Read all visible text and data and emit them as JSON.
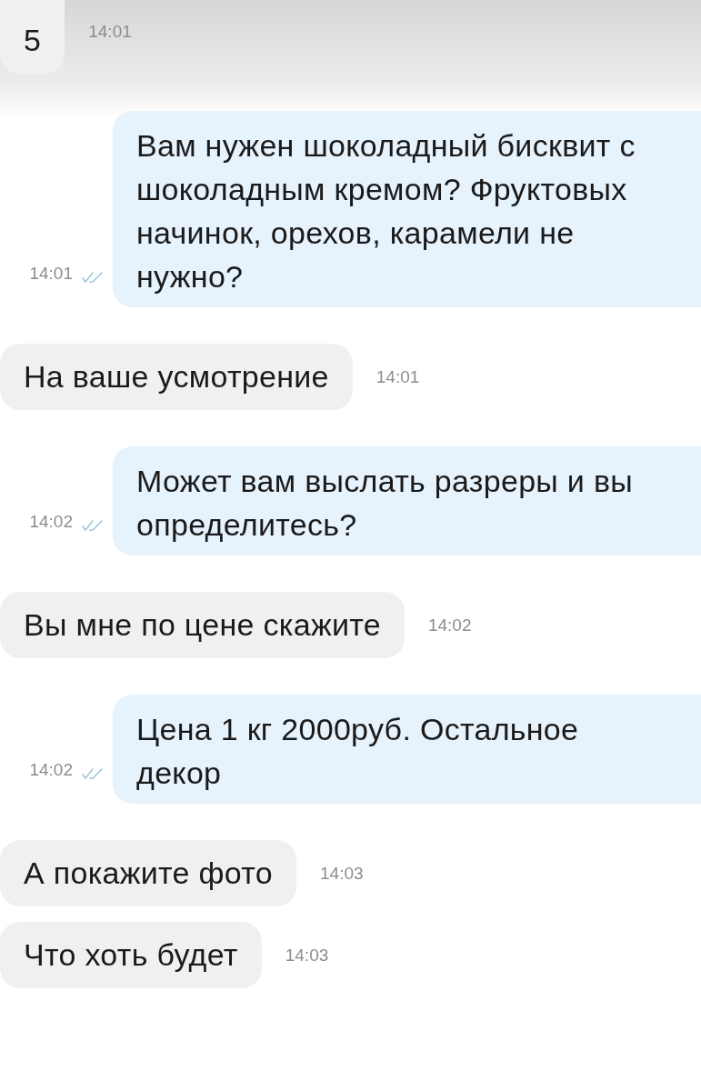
{
  "messages": [
    {
      "kind": "in",
      "text": "5",
      "time": "14:01",
      "cut_top": true
    },
    {
      "kind": "out",
      "text": "Вам нужен шоколадный бисквит с шоколадным кремом? Фруктовых начинок, орехов, карамели не нужно?",
      "time": "14:01",
      "read": true
    },
    {
      "kind": "in",
      "text": "На ваше усмотрение",
      "time": "14:01"
    },
    {
      "kind": "out",
      "text": "Может вам выслать разреры и вы определитесь?",
      "time": "14:02",
      "read": true
    },
    {
      "kind": "in",
      "text": "Вы мне по цене скажите",
      "time": "14:02"
    },
    {
      "kind": "out",
      "text": "Цена 1 кг 2000руб. Остальное декор",
      "time": "14:02",
      "read": true
    },
    {
      "kind": "in",
      "text": "А покажите фото",
      "time": "14:03"
    },
    {
      "kind": "in",
      "text": "Что хоть будет",
      "time": "14:03"
    }
  ]
}
